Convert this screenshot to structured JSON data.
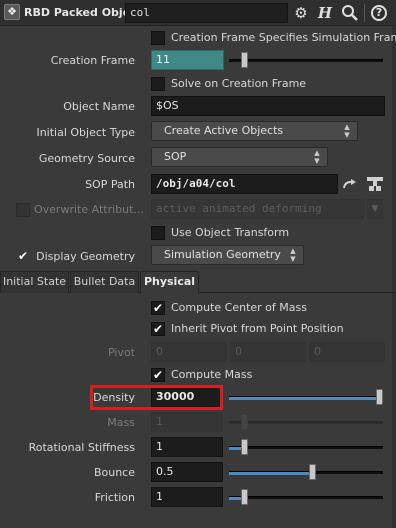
{
  "header": {
    "node_type": "RBD Packed Object",
    "node_name": "col",
    "icons": [
      "rbd-node-icon",
      "gear-icon",
      "houdini-help-h-icon",
      "search-icon",
      "help-icon"
    ]
  },
  "params": {
    "creation_frame_specifies": "Creation Frame Specifies Simulation Frame",
    "creation_frame_label": "Creation Frame",
    "creation_frame_value": "11",
    "solve_on_creation": "Solve on Creation Frame",
    "object_name_label": "Object Name",
    "object_name_value": "$OS",
    "initial_object_type_label": "Initial Object Type",
    "initial_object_type_value": "Create Active Objects",
    "geometry_source_label": "Geometry Source",
    "geometry_source_value": "SOP",
    "sop_path_label": "SOP Path",
    "sop_path_value": "/obj/a04/col",
    "overwrite_attr_label": "Overwrite Attribut...",
    "overwrite_attr_value": "active animated deforming",
    "use_object_transform": "Use Object Transform",
    "display_geometry_label": "Display Geometry",
    "display_geometry_value": "Simulation Geometry"
  },
  "tabs": [
    {
      "label": "Initial State"
    },
    {
      "label": "Bullet Data"
    },
    {
      "label": "Physical"
    }
  ],
  "active_tab": "Physical",
  "physical": {
    "compute_com": "Compute Center of Mass",
    "inherit_pivot": "Inherit Pivot from Point Position",
    "pivot_label": "Pivot",
    "pivot_values": [
      "0",
      "0",
      "0"
    ],
    "compute_mass": "Compute Mass",
    "density_label": "Density",
    "density_value": "30000",
    "density_slider": 1.0,
    "mass_label": "Mass",
    "mass_value": "1",
    "rot_stiff_label": "Rotational Stiffness",
    "rot_stiff_value": "1",
    "rot_stiff_slider": 0.0,
    "bounce_label": "Bounce",
    "bounce_value": "0.5",
    "bounce_slider": 0.5,
    "friction_label": "Friction",
    "friction_value": "1",
    "friction_slider": 0.0
  },
  "colors": {
    "background": "#3a3a3a",
    "field": "#1c1c1c",
    "teal_field": "#3f8a86",
    "slider_fill": "#4d8bbf",
    "highlight_box": "#d81f1f"
  }
}
